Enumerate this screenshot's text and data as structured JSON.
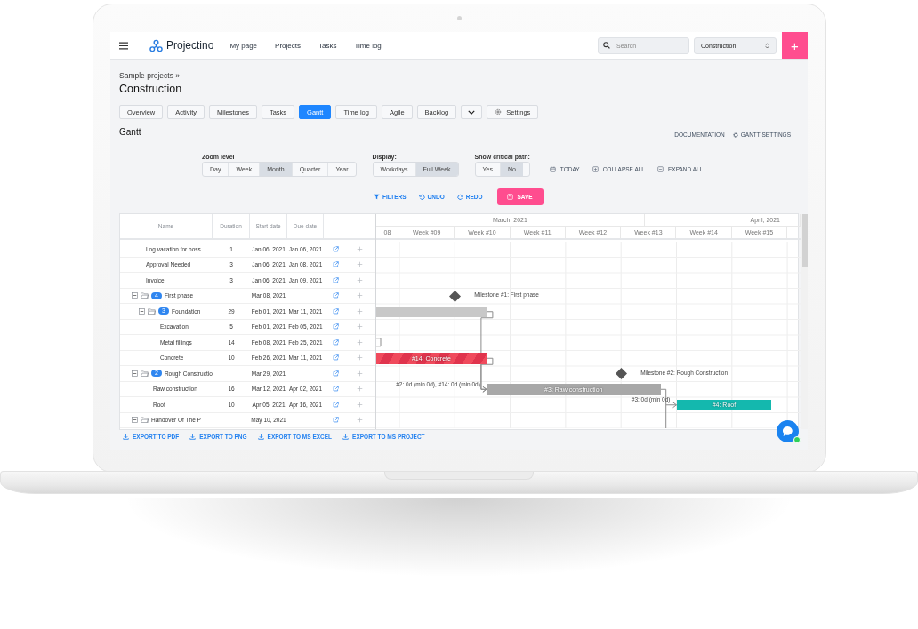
{
  "nav": {
    "brand": "Projectino",
    "links": [
      "My page",
      "Projects",
      "Tasks",
      "Time log"
    ],
    "search": {
      "placeholder": "Search"
    },
    "project_select": {
      "value": "Construction"
    },
    "add_button": "+"
  },
  "breadcrumb": "Sample projects »",
  "title": "Construction",
  "tabs": [
    {
      "kind": "text",
      "label": "Overview",
      "selected": false
    },
    {
      "kind": "text",
      "label": "Activity",
      "selected": false
    },
    {
      "kind": "text",
      "label": "Milestones",
      "selected": false
    },
    {
      "kind": "text",
      "label": "Tasks",
      "selected": false
    },
    {
      "kind": "text",
      "label": "Gantt",
      "selected": true
    },
    {
      "kind": "text",
      "label": "Time log",
      "selected": false
    },
    {
      "kind": "text",
      "label": "Agile",
      "selected": false
    },
    {
      "kind": "text",
      "label": "Backlog",
      "selected": false
    },
    {
      "kind": "more",
      "selected": false
    },
    {
      "kind": "settings",
      "label": "Settings",
      "selected": false
    }
  ],
  "gantt": {
    "heading": "Gantt",
    "links": [
      {
        "kind": "documentation",
        "label": "DOCUMENTATION"
      },
      {
        "kind": "settings",
        "label": "GANTT SETTINGS"
      }
    ],
    "option_groups": [
      {
        "label": "Zoom level",
        "options": [
          {
            "label": "Day",
            "selected": false
          },
          {
            "label": "Week",
            "selected": false
          },
          {
            "label": "Month",
            "selected": true
          },
          {
            "label": "Quarter",
            "selected": false
          },
          {
            "label": "Year",
            "selected": false
          }
        ]
      },
      {
        "label": "Display:",
        "options": [
          {
            "label": "Workdays",
            "selected": false
          },
          {
            "label": "Full Week",
            "selected": true
          }
        ]
      },
      {
        "label": "Show critical path:",
        "options": [
          {
            "label": "Yes",
            "selected": false
          },
          {
            "label": "No",
            "selected": true
          }
        ]
      }
    ],
    "view_actions": [
      {
        "kind": "today",
        "label": "TODAY"
      },
      {
        "kind": "collapse",
        "label": "COLLAPSE ALL"
      },
      {
        "kind": "expand",
        "label": "EXPAND ALL"
      }
    ],
    "edit_actions": [
      {
        "kind": "filters",
        "label": "FILTERS"
      },
      {
        "kind": "undo",
        "label": "UNDO"
      },
      {
        "kind": "redo",
        "label": "REDO"
      },
      {
        "kind": "save",
        "label": "SAVE"
      }
    ],
    "columns": [
      "Name",
      "Duration",
      "Start date",
      "Due date"
    ],
    "timeline": {
      "months": [
        "March, 2021",
        "April, 2021"
      ],
      "weeks": [
        "08",
        "Week #09",
        "Week #10",
        "Week #11",
        "Week #12",
        "Week #13",
        "Week #14",
        "Week #15"
      ]
    },
    "rows": [
      {
        "kind": "task",
        "name": "Log vacation for boss",
        "duration": "1",
        "start": "Jan 06, 2021",
        "due": "Jan 06, 2021"
      },
      {
        "kind": "task",
        "name": "Approval Needed",
        "duration": "3",
        "start": "Jan 06, 2021",
        "due": "Jan 08, 2021"
      },
      {
        "kind": "task",
        "name": "Invoice",
        "duration": "3",
        "start": "Jan 06, 2021",
        "due": "Jan 09, 2021"
      },
      {
        "kind": "group",
        "name": "First phase",
        "count": "4",
        "expanded": true,
        "start": "Mar 08, 2021",
        "milestone": {
          "label": "Milestone #1: First phase"
        },
        "children": [
          {
            "kind": "group",
            "name": "Foundation",
            "count": "3",
            "expanded": true,
            "duration": "29",
            "start": "Feb 01, 2021",
            "due": "Mar 11, 2021",
            "bar": {
              "color": "#c8c8c8",
              "critical": false
            },
            "children": [
              {
                "kind": "task",
                "name": "Excavation",
                "duration": "5",
                "start": "Feb 01, 2021",
                "due": "Feb 05, 2021"
              },
              {
                "kind": "task",
                "name": "Metal fillings",
                "duration": "14",
                "start": "Feb 08, 2021",
                "due": "Feb 25, 2021"
              },
              {
                "kind": "task",
                "name": "Concrete",
                "duration": "10",
                "start": "Feb 26, 2021",
                "due": "Mar 11, 2021",
                "bar": {
                  "label": "#14: Concrete",
                  "color": "#f04a5c",
                  "critical": true
                }
              }
            ]
          }
        ]
      },
      {
        "kind": "group",
        "name": "Rough Constructio",
        "count": "2",
        "expanded": true,
        "start": "Mar 29, 2021",
        "milestone": {
          "label": "Milestone #2: Rough Construction"
        },
        "children": [
          {
            "kind": "task",
            "name": "Raw construction",
            "duration": "16",
            "start": "Mar 12, 2021",
            "due": "Apr 02, 2021",
            "link_label": "#2: 0d (min 0d), #14: 0d (min 0d)",
            "bar": {
              "label": "#3: Raw construction",
              "color": "#a8a8a8",
              "critical": false
            }
          },
          {
            "kind": "task",
            "name": "Roof",
            "duration": "10",
            "start": "Apr 05, 2021",
            "due": "Apr 16, 2021",
            "link_label": "#3: 0d (min 0d)",
            "bar": {
              "label": "#4: Roof",
              "color": "#14b8ae",
              "critical": false
            }
          }
        ]
      },
      {
        "kind": "group",
        "name": "Handover Of The P",
        "expanded": true,
        "start": "May 10, 2021"
      }
    ],
    "exports": [
      "EXPORT TO PDF",
      "EXPORT TO PNG",
      "EXPORT TO MS EXCEL",
      "EXPORT TO MS PROJECT"
    ]
  }
}
